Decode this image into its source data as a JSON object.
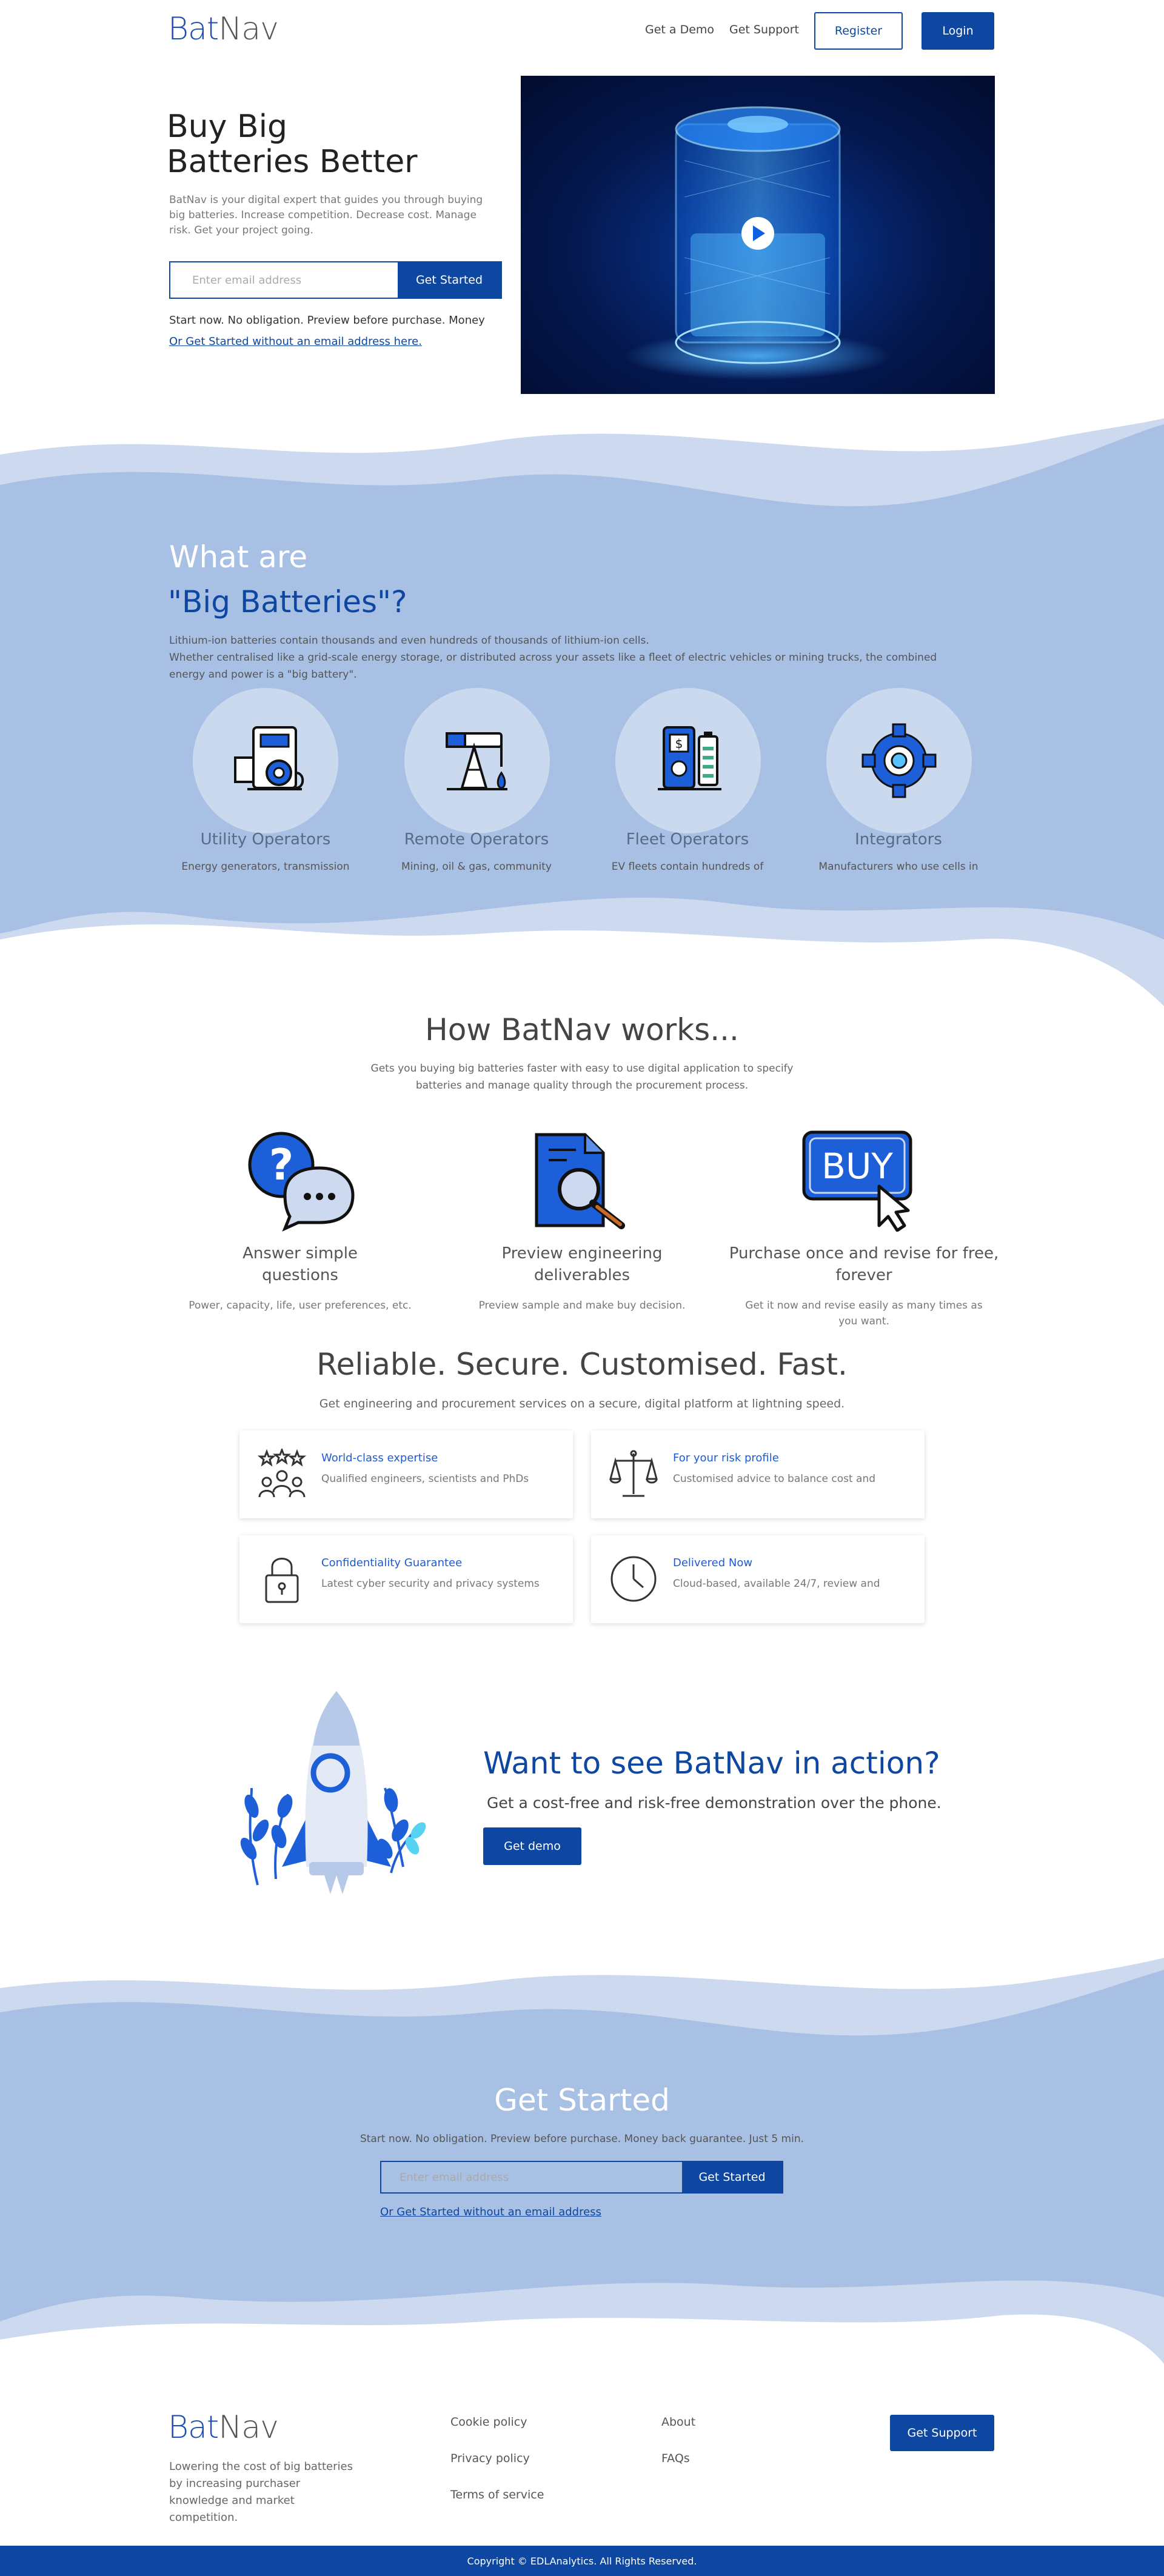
{
  "header": {
    "logo_bat": "Bat",
    "logo_nav": "Nav",
    "nav_demo": "Get a Demo",
    "nav_support": "Get Support",
    "register_label": "Register",
    "login_label": "Login"
  },
  "hero": {
    "title": "Buy Big Batteries Better",
    "description": "BatNav is your digital expert that guides you through buying big batteries. Increase competition. Decrease cost. Manage risk. Get your project going.",
    "email_placeholder": "Enter email address",
    "cta_label": "Get Started",
    "note": "Start now. No obligation. Preview before purchase. Money",
    "alt_link": "Or Get Started without an email address here."
  },
  "what_are": {
    "title": "What are",
    "subtitle": "\"Big Batteries\"?",
    "desc_line1": "Lithium-ion batteries contain thousands and even hundreds of thousands of lithium-ion cells.",
    "desc_line2": "Whether centralised like a grid-scale energy storage, or distributed across your assets like a fleet of electric vehicles or mining trucks, the combined energy and power is a \"big battery\".",
    "operators": [
      {
        "title": "Utility Operators",
        "desc": "Energy generators, transmission",
        "icon": "utility-icon"
      },
      {
        "title": "Remote Operators",
        "desc": "Mining, oil & gas, community",
        "icon": "oil-pump-icon"
      },
      {
        "title": "Fleet Operators",
        "desc": "EV fleets contain hundreds of",
        "icon": "ev-charger-icon"
      },
      {
        "title": "Integrators",
        "desc": "Manufacturers who use cells in",
        "icon": "gear-icon"
      }
    ]
  },
  "how_works": {
    "title": "How BatNav works...",
    "desc_line1": "Gets you buying big batteries faster with easy to use digital application to specify",
    "desc_line2": "batteries and manage quality through the procurement process.",
    "steps": [
      {
        "title_line1": "Answer simple",
        "title_line2": "questions",
        "desc_line1": "Power, capacity, life, user preferences, etc.",
        "desc_line2": "",
        "icon": "question-chat-icon"
      },
      {
        "title_line1": "Preview engineering",
        "title_line2": "deliverables",
        "desc_line1": "Preview sample and make buy decision.",
        "desc_line2": "",
        "icon": "document-search-icon"
      },
      {
        "title_line1": "Purchase once and revise for free,",
        "title_line2": "forever",
        "desc_line1": "Get it now and revise easily as many times as",
        "desc_line2": "you want.",
        "icon": "buy-button-icon"
      }
    ]
  },
  "reliable": {
    "title": "Reliable. Secure. Customised. Fast.",
    "desc": "Get engineering and procurement services on a secure, digital platform at lightning speed.",
    "cards": [
      {
        "title": "World-class expertise",
        "desc": "Qualified engineers,  scientists and PhDs",
        "icon": "experts-icon"
      },
      {
        "title": "For your risk profile",
        "desc": "Customised advice to balance cost and",
        "icon": "scales-icon"
      },
      {
        "title": "Confidentiality Guarantee",
        "desc": "Latest cyber security and privacy systems",
        "icon": "lock-icon"
      },
      {
        "title": "Delivered Now",
        "desc": "Cloud-based, available 24/7, review and",
        "icon": "clock-icon"
      }
    ]
  },
  "cta": {
    "title": "Want to see BatNav in action?",
    "desc": "Get a cost-free and risk-free demonstration over the phone.",
    "button_label": "Get demo"
  },
  "get_started": {
    "title": "Get Started",
    "desc": "Start now. No obligation. Preview before purchase. Money back guarantee. Just 5 min.",
    "email_placeholder": "Enter email address",
    "button_label": "Get Started",
    "alt_link": "Or Get Started without an email address"
  },
  "footer": {
    "logo_bat": "Bat",
    "logo_nav": "Nav",
    "description": "Lowering the cost of big batteries by increasing purchaser knowledge and market competition.",
    "links_col1": [
      "Cookie policy",
      "Privacy policy",
      "Terms of service"
    ],
    "links_col2": [
      "About",
      "FAQs"
    ],
    "support_label": "Get Support",
    "copyright": "Copyright © EDLAnalytics. All Rights Reserved."
  },
  "colors": {
    "brand": "#0d47a1",
    "wave_light": "#cdd9ee",
    "wave_mid": "#a8c0e4"
  }
}
